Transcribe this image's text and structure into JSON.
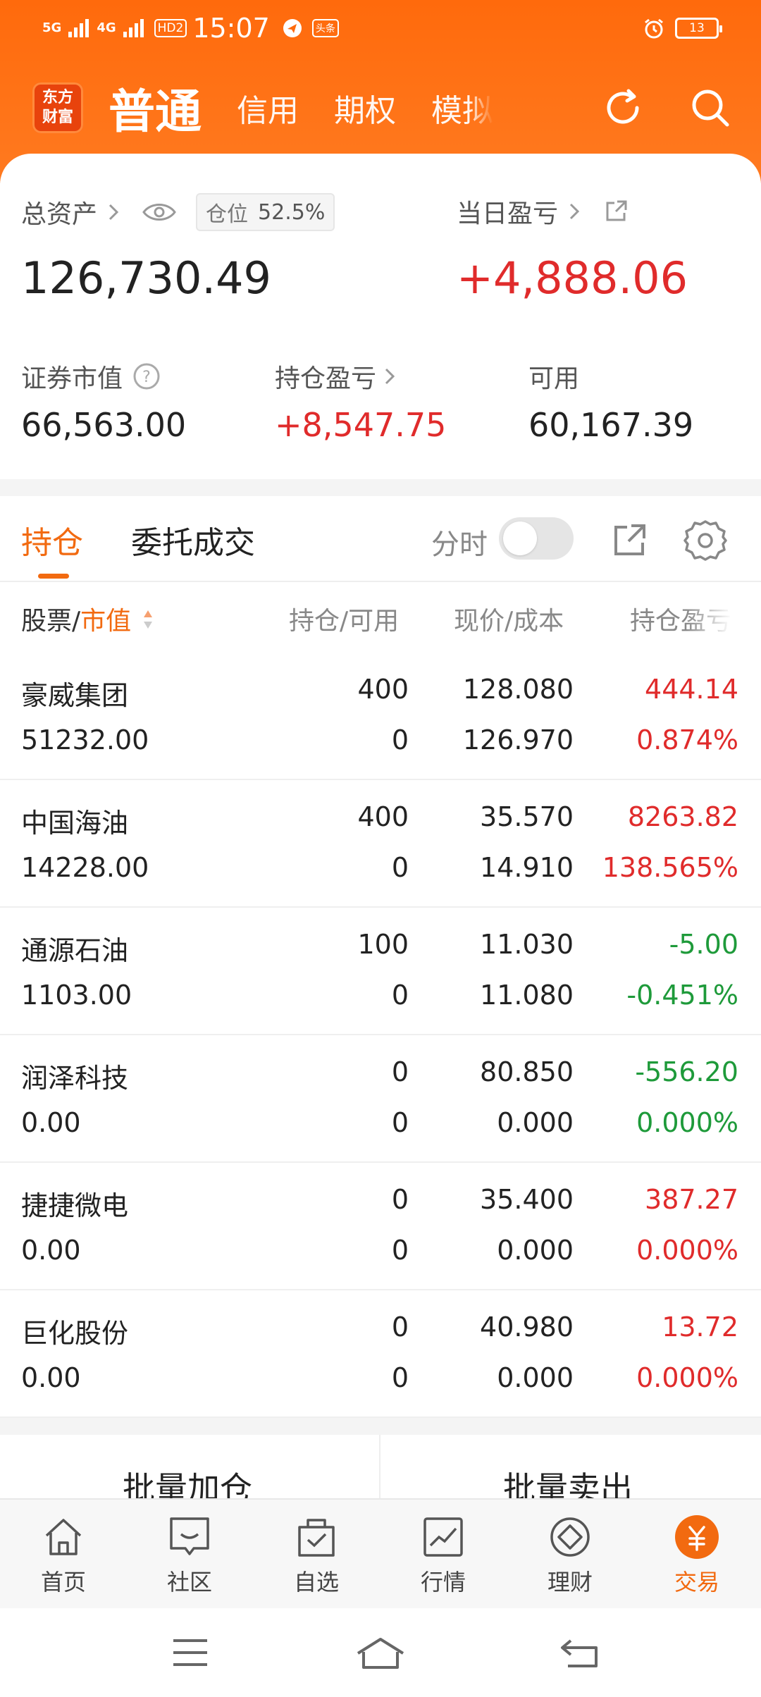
{
  "status_bar": {
    "signal_1": "5G",
    "signal_2": "4G",
    "hd_badge": "HD2",
    "time": "15:07",
    "app_badge": "头条",
    "battery": "13"
  },
  "header": {
    "logo_line1": "东方",
    "logo_line2": "财富",
    "tabs": [
      "普通",
      "信用",
      "期权",
      "模拟"
    ],
    "active_tab": "普通"
  },
  "account": {
    "total_assets_label": "总资产",
    "total_assets_value": "126,730.49",
    "position_label": "仓位",
    "position_pct": "52.5%",
    "daily_pnl_label": "当日盈亏",
    "daily_pnl_value": "+4,888.06",
    "market_value_label": "证券市值",
    "market_value": "66,563.00",
    "holding_pnl_label": "持仓盈亏",
    "holding_pnl": "+8,547.75",
    "available_label": "可用",
    "available_value": "60,167.39"
  },
  "tabs": {
    "holdings": "持仓",
    "orders": "委托成交",
    "timeshare_label": "分时"
  },
  "table": {
    "col_stock": "股票/",
    "col_stock_sort": "市值",
    "col_position": "持仓/可用",
    "col_price": "现价/成本",
    "col_pnl": "持仓盈亏",
    "rows": [
      {
        "name": "豪威集团",
        "market_value": "51232.00",
        "position": "400",
        "available": "0",
        "price": "128.080",
        "cost": "126.970",
        "pnl": "444.14",
        "pnl_pct": "0.874%",
        "trend": "up"
      },
      {
        "name": "中国海油",
        "market_value": "14228.00",
        "position": "400",
        "available": "0",
        "price": "35.570",
        "cost": "14.910",
        "pnl": "8263.82",
        "pnl_pct": "138.565%",
        "trend": "up"
      },
      {
        "name": "通源石油",
        "market_value": "1103.00",
        "position": "100",
        "available": "0",
        "price": "11.030",
        "cost": "11.080",
        "pnl": "-5.00",
        "pnl_pct": "-0.451%",
        "trend": "down"
      },
      {
        "name": "润泽科技",
        "market_value": "0.00",
        "position": "0",
        "available": "0",
        "price": "80.850",
        "cost": "0.000",
        "pnl": "-556.20",
        "pnl_pct": "0.000%",
        "trend": "down"
      },
      {
        "name": "捷捷微电",
        "market_value": "0.00",
        "position": "0",
        "available": "0",
        "price": "35.400",
        "cost": "0.000",
        "pnl": "387.27",
        "pnl_pct": "0.000%",
        "trend": "up"
      },
      {
        "name": "巨化股份",
        "market_value": "0.00",
        "position": "0",
        "available": "0",
        "price": "40.980",
        "cost": "0.000",
        "pnl": "13.72",
        "pnl_pct": "0.000%",
        "trend": "up"
      }
    ]
  },
  "actions": {
    "batch_add": "批量加仓",
    "batch_sell": "批量卖出"
  },
  "bottom_nav": [
    {
      "label": "首页",
      "icon": "home-icon"
    },
    {
      "label": "社区",
      "icon": "community-icon"
    },
    {
      "label": "自选",
      "icon": "watchlist-icon"
    },
    {
      "label": "行情",
      "icon": "market-chart-icon"
    },
    {
      "label": "理财",
      "icon": "wealth-icon"
    },
    {
      "label": "交易",
      "icon": "trade-icon",
      "active": true
    }
  ],
  "colors": {
    "brand_orange": "#ff6a0c",
    "accent": "#f26a10",
    "up_red": "#e02b2b",
    "down_green": "#1e9a3a"
  }
}
